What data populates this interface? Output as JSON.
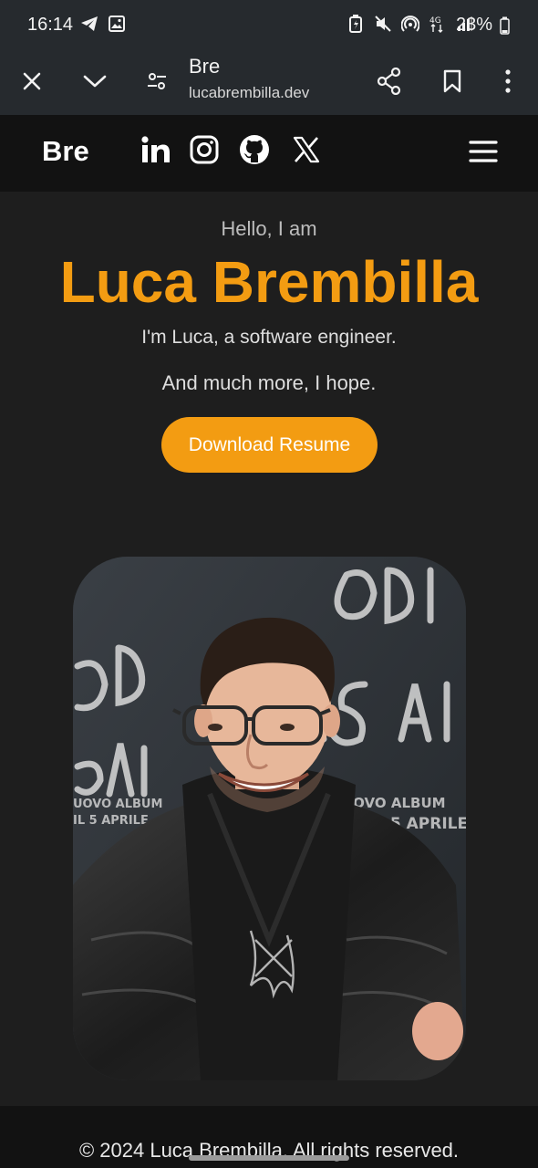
{
  "status_bar": {
    "time": "16:14",
    "battery": "23%",
    "icons": [
      "telegram-icon",
      "image-icon",
      "battery-saver-icon",
      "mute-icon",
      "hotspot-icon",
      "4g-icon",
      "signal-icon",
      "battery-icon"
    ]
  },
  "browser": {
    "title": "Bre",
    "url": "lucabrembilla.dev",
    "icons": [
      "close-icon",
      "chevron-down-icon",
      "tune-icon",
      "share-icon",
      "bookmark-icon",
      "more-icon"
    ]
  },
  "nav": {
    "logo": "Bre",
    "socials": [
      "linkedin-icon",
      "instagram-icon",
      "github-icon",
      "x-icon"
    ],
    "menu_icon": "menu-icon"
  },
  "hero": {
    "greeting": "Hello, I am",
    "name": "Luca Brembilla",
    "intro": "I'm Luca, a software engineer.",
    "tagline": "And much more, I hope.",
    "resume_button": "Download Resume"
  },
  "footer": {
    "text": "© 2024 Luca Brembilla. All rights reserved."
  },
  "colors": {
    "accent": "#f39c12",
    "background": "#1e1e1e",
    "nav_background": "#121212",
    "browser_chrome": "#262a2e"
  }
}
